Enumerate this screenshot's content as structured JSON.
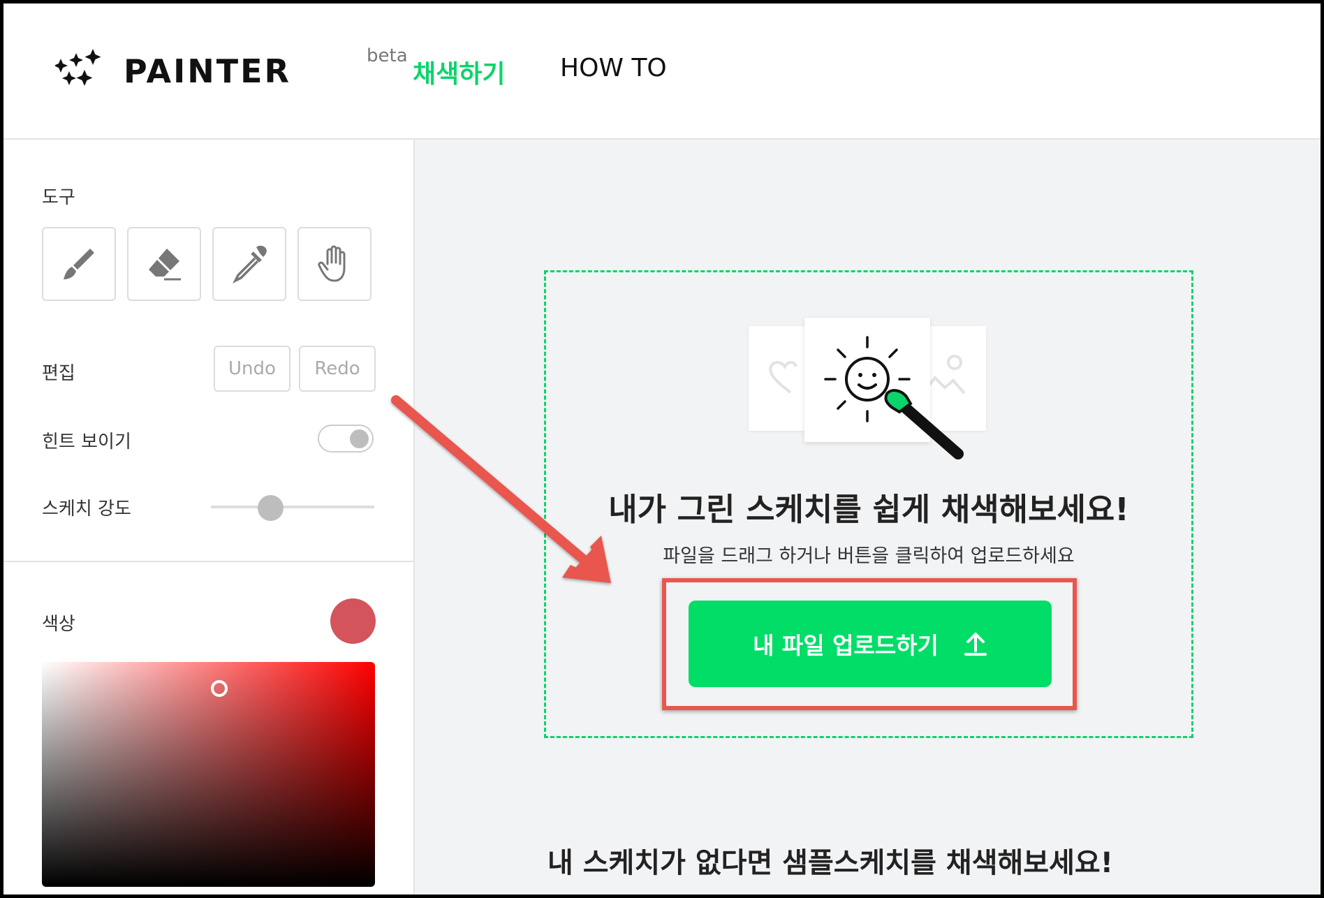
{
  "header": {
    "logo_text": "PAINTER",
    "logo_badge": "beta",
    "nav": [
      {
        "label": "채색하기",
        "active": true
      },
      {
        "label": "HOW TO",
        "active": false
      }
    ],
    "accent_color": "#0bd46a"
  },
  "sidebar": {
    "tools_label": "도구",
    "tools": [
      "brush-icon",
      "eraser-icon",
      "eyedropper-icon",
      "hand-icon"
    ],
    "edit_label": "편집",
    "undo_label": "Undo",
    "redo_label": "Redo",
    "hint_label": "힌트 보이기",
    "sketch_strength_label": "스케치 강도",
    "sketch_strength_value": 0.36,
    "color_label": "색상",
    "selected_color": "#d4545c"
  },
  "main": {
    "dropzone_title": "내가 그린 스케치를 쉽게 채색해보세요!",
    "dropzone_subtitle": "파일을 드래그 하거나 버튼을 클릭하여 업로드하세요",
    "upload_button_label": "내 파일 업로드하기",
    "sample_title": "내 스케치가 없다면 샘플스케치를 채색해보세요!",
    "upload_button_color": "#02dd68"
  },
  "annotation": {
    "highlight_color": "#e8574e"
  }
}
